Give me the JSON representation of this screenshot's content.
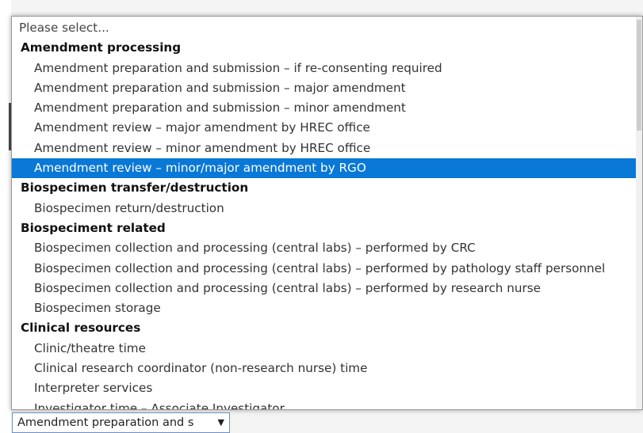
{
  "listbox": {
    "placeholder": "Please select...",
    "rows": [
      {
        "type": "group",
        "label": "Amendment processing"
      },
      {
        "type": "option",
        "label": "Amendment preparation and submission – if re-consenting required"
      },
      {
        "type": "option",
        "label": "Amendment preparation and submission – major amendment"
      },
      {
        "type": "option",
        "label": "Amendment preparation and submission – minor amendment"
      },
      {
        "type": "option",
        "label": "Amendment review – major amendment by HREC office"
      },
      {
        "type": "option",
        "label": "Amendment review – minor amendment by HREC office"
      },
      {
        "type": "option",
        "label": "Amendment review – minor/major amendment by RGO",
        "selected": true
      },
      {
        "type": "group",
        "label": "Biospecimen transfer/destruction"
      },
      {
        "type": "option",
        "label": "Biospecimen return/destruction"
      },
      {
        "type": "group",
        "label": "Biospeciment related"
      },
      {
        "type": "option",
        "label": "Biospecimen collection and processing (central labs) – performed by CRC"
      },
      {
        "type": "option",
        "label": "Biospecimen collection and processing (central labs) – performed by pathology staff personnel"
      },
      {
        "type": "option",
        "label": "Biospecimen collection and processing (central labs) – performed by research nurse"
      },
      {
        "type": "option",
        "label": "Biospecimen storage"
      },
      {
        "type": "group",
        "label": "Clinical resources"
      },
      {
        "type": "option",
        "label": "Clinic/theatre time"
      },
      {
        "type": "option",
        "label": "Clinical research coordinator (non-research nurse) time"
      },
      {
        "type": "option",
        "label": "Interpreter services"
      },
      {
        "type": "option",
        "label": "Investigator time – Associate Investigator"
      }
    ]
  },
  "select": {
    "value": "Amendment preparation and s",
    "arrow_icon": "dropdown-arrow-icon"
  },
  "colors": {
    "selected_bg": "#0a78d7",
    "selected_text": "#ffffff"
  }
}
